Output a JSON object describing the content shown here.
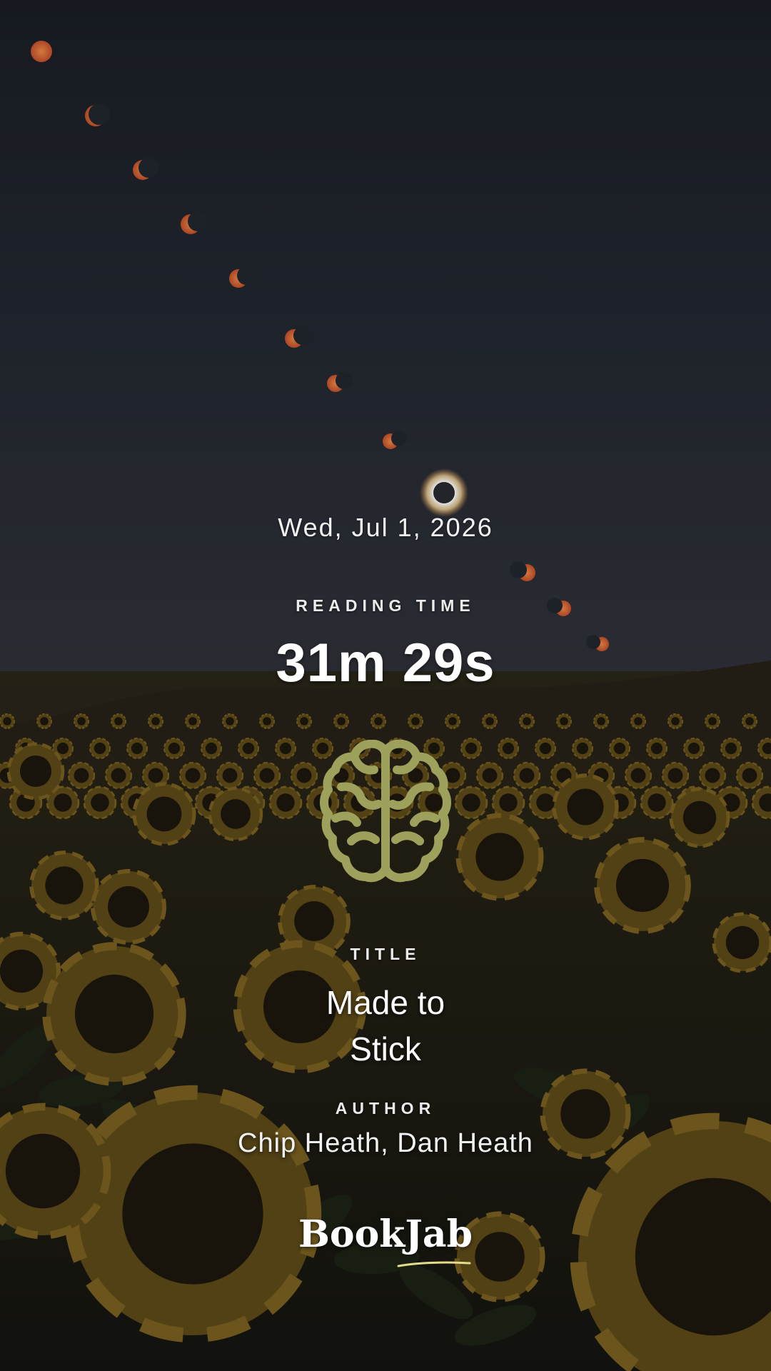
{
  "screen": {
    "date": "Wed, Jul 1, 2026",
    "reading_time_label": "READING TIME",
    "reading_time": "31m 29s",
    "title_label": "TITLE",
    "title_line1": "Made to",
    "title_line2": "Stick",
    "author_label": "AUTHOR",
    "author": "Chip Heath, Dan Heath",
    "brand": "BookJab"
  },
  "icons": {
    "topic": "brain-icon"
  },
  "colors": {
    "brain_icon": "#9ea15c",
    "brand_underline": "#e3dc8a",
    "eclipse_orange": "#d9653a",
    "text": "#ffffff"
  }
}
